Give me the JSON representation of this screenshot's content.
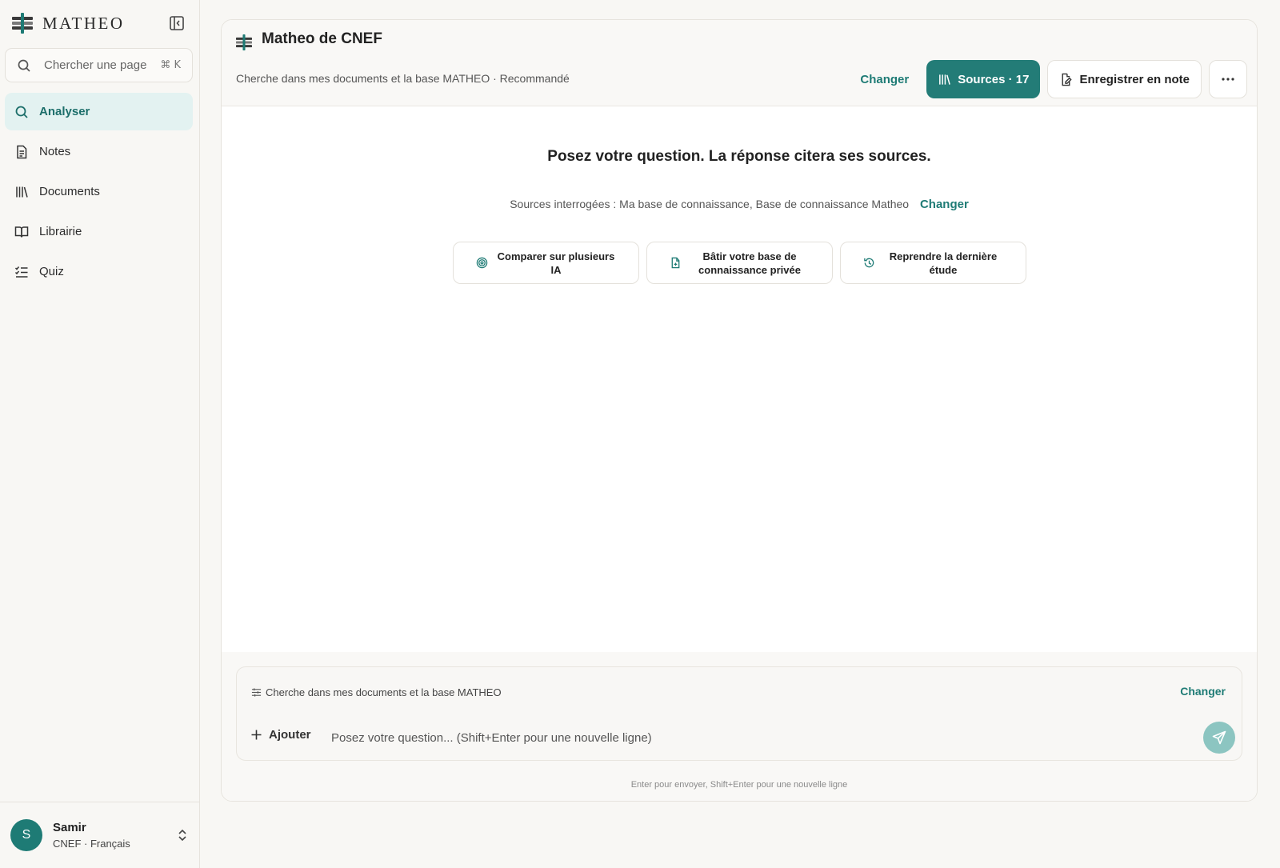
{
  "sidebar": {
    "brand": "MATHEO",
    "search": {
      "placeholder": "Chercher une page",
      "shortcut": "⌘ K"
    },
    "items": [
      {
        "label": "Analyser",
        "icon": "search-icon",
        "active": true
      },
      {
        "label": "Notes",
        "icon": "document-icon"
      },
      {
        "label": "Documents",
        "icon": "library-icon"
      },
      {
        "label": "Librairie",
        "icon": "book-icon"
      },
      {
        "label": "Quiz",
        "icon": "checklist-icon"
      }
    ],
    "user": {
      "initial": "S",
      "name": "Samir",
      "subtitle": "CNEF · Français"
    }
  },
  "header": {
    "title": "Matheo de CNEF",
    "mode": "Cherche dans mes documents et la base MATHEO · Recommandé",
    "change_label": "Changer",
    "sources_label": "Sources · 17",
    "save_label": "Enregistrer en note",
    "more_icon": "more-horizontal-icon"
  },
  "main": {
    "prompt_title": "Posez votre question. La réponse citera ses sources.",
    "sources_line": "Sources interrogées : Ma base de connaissance, Base de connaissance Matheo",
    "sources_change": "Changer",
    "suggestions": [
      {
        "label": "Comparer sur plusieurs IA",
        "icon": "target-icon"
      },
      {
        "label": "Bâtir votre base de connaissance privée",
        "icon": "file-plus-icon"
      },
      {
        "label": "Reprendre la dernière étude",
        "icon": "history-icon"
      }
    ]
  },
  "composer": {
    "mode": "Cherche dans mes documents et la base MATHEO",
    "change_label": "Changer",
    "add_label": "Ajouter",
    "placeholder": "Posez votre question... (Shift+Enter pour une nouvelle ligne)",
    "value": "",
    "hint": "Enter pour envoyer, Shift+Enter pour une nouvelle ligne"
  },
  "colors": {
    "accent": "#237c77",
    "active_bg": "#e3f2f1",
    "send": "#8cc5c1"
  }
}
